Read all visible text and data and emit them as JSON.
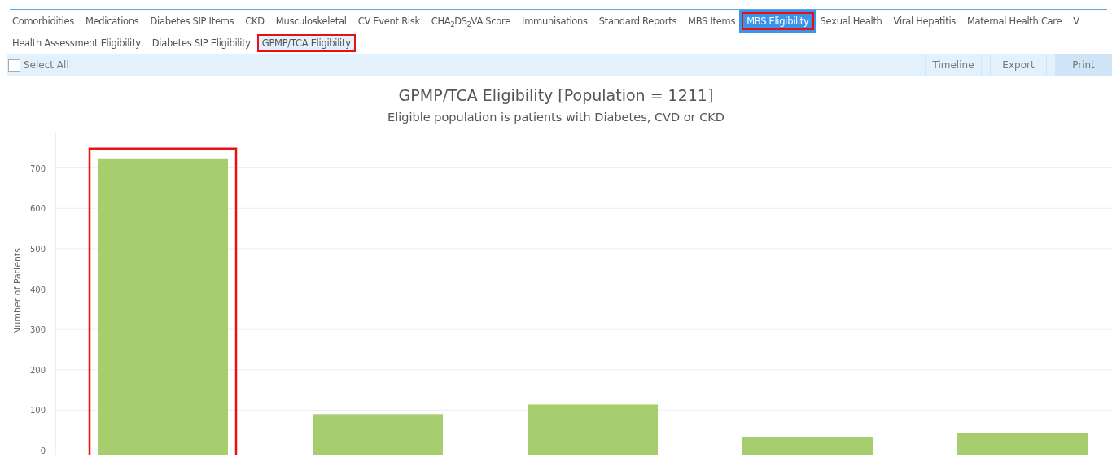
{
  "tabs_row_1": [
    {
      "label": "Comorbidities",
      "selected": false,
      "highlighted": false
    },
    {
      "label": "Medications",
      "selected": false,
      "highlighted": false
    },
    {
      "label": "Diabetes SIP Items",
      "selected": false,
      "highlighted": false
    },
    {
      "label": "CKD",
      "selected": false,
      "highlighted": false
    },
    {
      "label": "Musculoskeletal",
      "selected": false,
      "highlighted": false
    },
    {
      "label": "CV Event Risk",
      "selected": false,
      "highlighted": false
    },
    {
      "label": "CHA$_{2}$DS$_{2}$VA Score",
      "selected": false,
      "highlighted": false
    },
    {
      "label": "Immunisations",
      "selected": false,
      "highlighted": false
    },
    {
      "label": "Standard Reports",
      "selected": false,
      "highlighted": false
    },
    {
      "label": "MBS Items",
      "selected": false,
      "highlighted": false
    },
    {
      "label": "MBS Eligibility",
      "selected": true,
      "highlighted": true
    },
    {
      "label": "Sexual Health",
      "selected": false,
      "highlighted": false
    },
    {
      "label": "Viral Hepatitis",
      "selected": false,
      "highlighted": false
    },
    {
      "label": "Maternal Health Care",
      "selected": false,
      "highlighted": false
    },
    {
      "label": "V",
      "selected": false,
      "highlighted": false
    }
  ],
  "tabs_row_2": [
    {
      "label": "Health Assessment Eligibility",
      "selected": false,
      "highlighted": false
    },
    {
      "label": "Diabetes SIP Eligibility",
      "selected": false,
      "highlighted": false
    },
    {
      "label": "GPMP/TCA Eligibility",
      "selected": true,
      "highlighted": true
    }
  ],
  "toolbar": {
    "select_all": {
      "label": "Select All",
      "checked": false
    },
    "buttons": [
      {
        "label": "Timeline",
        "selected": false
      },
      {
        "label": "Export",
        "selected": false
      },
      {
        "label": "Print",
        "selected": true
      }
    ]
  },
  "chart": {
    "title": "GPMP/TCA Eligibility [Population = 1211]",
    "subtitle": "Eligible population is patients with Diabetes, CVD or CKD",
    "chart_data": {
      "type": "bar",
      "ylabel": "Number of Patients",
      "ylim": [
        0,
        790
      ],
      "grid": true,
      "yticks": [
        0,
        100,
        200,
        300,
        400,
        500,
        600,
        700
      ],
      "series": [
        {
          "color": "#a6ce6e",
          "values": [
            724,
            90,
            114,
            34,
            44
          ]
        }
      ]
    },
    "first_bar_highlighted": true
  }
}
